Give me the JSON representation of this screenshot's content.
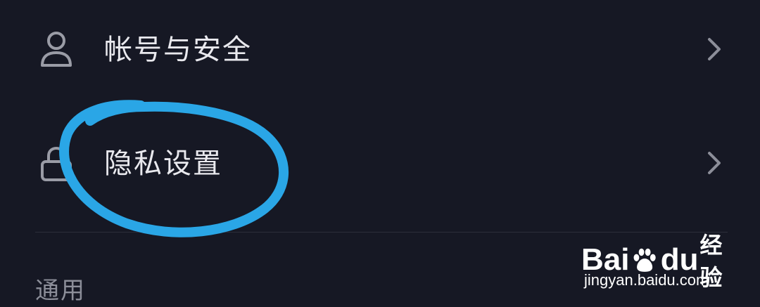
{
  "settings": {
    "items": [
      {
        "label": "帐号与安全",
        "icon": "person-icon"
      },
      {
        "label": "隐私设置",
        "icon": "lock-icon"
      }
    ],
    "section_general": "通用"
  },
  "watermark": {
    "brand": "Baidu经验",
    "brand_left": "Bai",
    "brand_right": "du",
    "brand_suffix": "经验",
    "url": "jingyan.baidu.com"
  },
  "colors": {
    "background": "#161824",
    "text": "#e9e9ee",
    "secondary_text": "#8c8e99",
    "icon": "#9a9ca6",
    "highlight_stroke": "#2aa6e6"
  }
}
